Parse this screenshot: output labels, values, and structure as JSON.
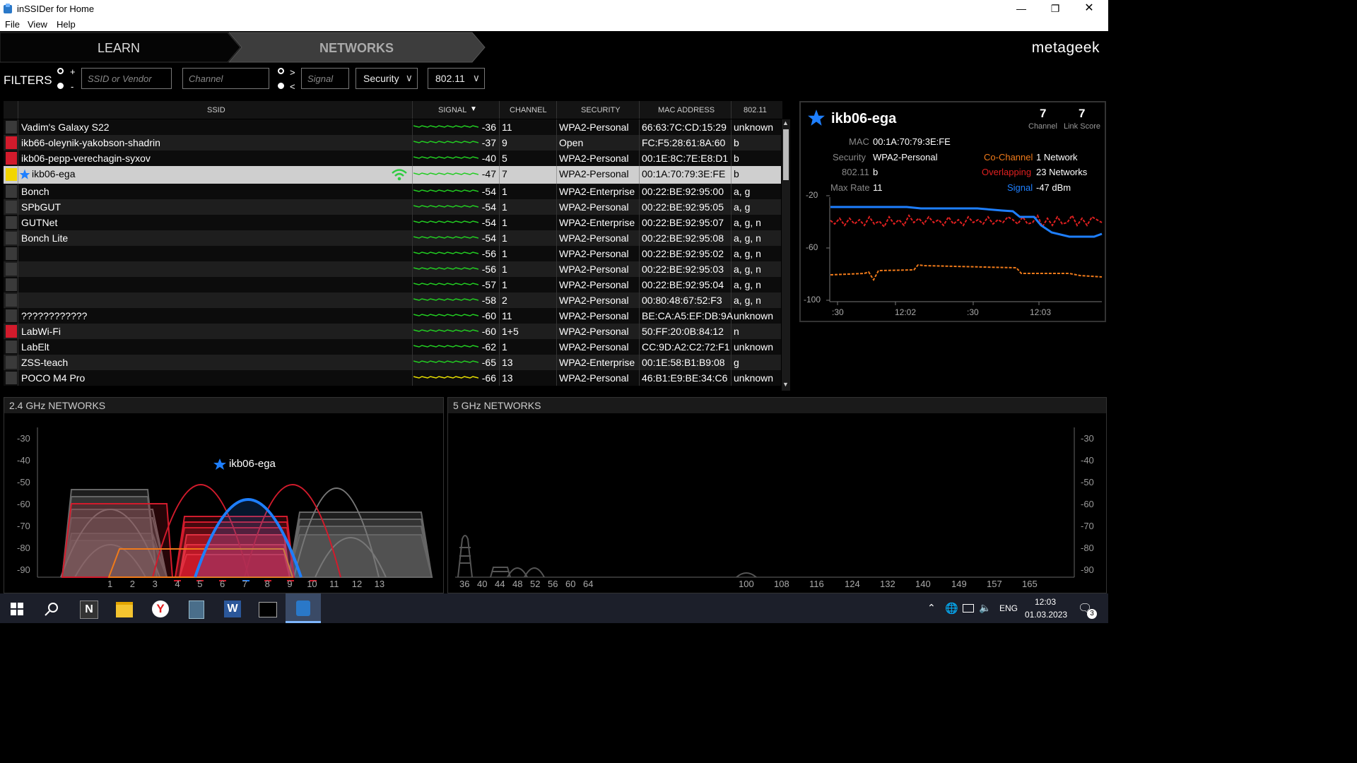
{
  "app": {
    "title": "inSSIDer for Home"
  },
  "menu": [
    "File",
    "View",
    "Help"
  ],
  "nav": {
    "learn": "LEARN",
    "networks": "NETWORKS",
    "brand": "metageek"
  },
  "filters": {
    "label": "FILTERS",
    "plus": "+",
    "minus": "-",
    "gt": ">",
    "lt": "<",
    "ssid_placeholder": "SSID or Vendor",
    "channel_placeholder": "Channel",
    "signal_placeholder": "Signal",
    "security": "Security",
    "dot11": "802.11"
  },
  "table": {
    "headers": {
      "ssid": "SSID",
      "signal": "SIGNAL",
      "channel": "CHANNEL",
      "security": "SECURITY",
      "mac": "MAC ADDRESS",
      "dot11": "802.11"
    },
    "rows": [
      {
        "color": "#3a3a3a",
        "ssid": "Vadim's Galaxy S22",
        "signal": "-36",
        "channel": "11",
        "security": "WPA2-Personal",
        "mac": "66:63:7C:CD:15:29",
        "dot11": "unknown",
        "spark": "#22cc22"
      },
      {
        "color": "#d21b2c",
        "ssid": "ikb66-oleynik-yakobson-shadrin",
        "signal": "-37",
        "channel": "9",
        "security": "Open",
        "mac": "FC:F5:28:61:8A:60",
        "dot11": "b",
        "spark": "#22cc22"
      },
      {
        "color": "#d21b2c",
        "ssid": "ikb06-pepp-verechagin-syxov",
        "signal": "-40",
        "channel": "5",
        "security": "WPA2-Personal",
        "mac": "00:1E:8C:7E:E8:D1",
        "dot11": "b",
        "spark": "#22cc22"
      },
      {
        "color": "#f2d600",
        "ssid": "ikb06-ega",
        "signal": "-47",
        "channel": "7",
        "security": "WPA2-Personal",
        "mac": "00:1A:70:79:3E:FE",
        "dot11": "b",
        "spark": "#22cc22",
        "selected": true
      },
      {
        "color": "#3a3a3a",
        "ssid": "Bonch",
        "signal": "-54",
        "channel": "1",
        "security": "WPA2-Enterprise",
        "mac": "00:22:BE:92:95:00",
        "dot11": "a, g",
        "spark": "#22cc22"
      },
      {
        "color": "#3a3a3a",
        "ssid": "SPbGUT",
        "signal": "-54",
        "channel": "1",
        "security": "WPA2-Personal",
        "mac": "00:22:BE:92:95:05",
        "dot11": "a, g",
        "spark": "#22cc22"
      },
      {
        "color": "#3a3a3a",
        "ssid": "GUTNet",
        "signal": "-54",
        "channel": "1",
        "security": "WPA2-Enterprise",
        "mac": "00:22:BE:92:95:07",
        "dot11": "a, g, n",
        "spark": "#22cc22"
      },
      {
        "color": "#3a3a3a",
        "ssid": "Bonch Lite",
        "signal": "-54",
        "channel": "1",
        "security": "WPA2-Personal",
        "mac": "00:22:BE:92:95:08",
        "dot11": "a, g, n",
        "spark": "#22cc22"
      },
      {
        "color": "#3a3a3a",
        "ssid": "",
        "signal": "-56",
        "channel": "1",
        "security": "WPA2-Personal",
        "mac": "00:22:BE:92:95:02",
        "dot11": "a, g, n",
        "spark": "#22cc22"
      },
      {
        "color": "#3a3a3a",
        "ssid": "",
        "signal": "-56",
        "channel": "1",
        "security": "WPA2-Personal",
        "mac": "00:22:BE:92:95:03",
        "dot11": "a, g, n",
        "spark": "#22cc22"
      },
      {
        "color": "#3a3a3a",
        "ssid": "",
        "signal": "-57",
        "channel": "1",
        "security": "WPA2-Personal",
        "mac": "00:22:BE:92:95:04",
        "dot11": "a, g, n",
        "spark": "#22cc22"
      },
      {
        "color": "#3a3a3a",
        "ssid": "",
        "signal": "-58",
        "channel": "2",
        "security": "WPA2-Personal",
        "mac": "00:80:48:67:52:F3",
        "dot11": "a, g, n",
        "spark": "#22cc22"
      },
      {
        "color": "#3a3a3a",
        "ssid": "????????????",
        "signal": "-60",
        "channel": "11",
        "security": "WPA2-Personal",
        "mac": "BE:CA:A5:EF:DB:9A",
        "dot11": "unknown",
        "spark": "#22cc22"
      },
      {
        "color": "#d21b2c",
        "ssid": "LabWi-Fi",
        "signal": "-60",
        "channel": "1+5",
        "security": "WPA2-Personal",
        "mac": "50:FF:20:0B:84:12",
        "dot11": "n",
        "spark": "#22cc22"
      },
      {
        "color": "#3a3a3a",
        "ssid": "LabElt",
        "signal": "-62",
        "channel": "1",
        "security": "WPA2-Personal",
        "mac": "CC:9D:A2:C2:72:F1",
        "dot11": "unknown",
        "spark": "#22cc22"
      },
      {
        "color": "#3a3a3a",
        "ssid": "ZSS-teach",
        "signal": "-65",
        "channel": "13",
        "security": "WPA2-Enterprise",
        "mac": "00:1E:58:B1:B9:08",
        "dot11": "g",
        "spark": "#22cc22"
      },
      {
        "color": "#3a3a3a",
        "ssid": "POCO M4 Pro",
        "signal": "-66",
        "channel": "13",
        "security": "WPA2-Personal",
        "mac": "46:B1:E9:BE:34:C6",
        "dot11": "unknown",
        "spark": "#e8e000"
      }
    ]
  },
  "detail": {
    "ssid": "ikb06-ega",
    "channel_value": "7",
    "channel_label": "Channel",
    "linkscore_value": "7",
    "linkscore_label": "Link Score",
    "mac_label": "MAC",
    "mac": "00:1A:70:79:3E:FE",
    "security_label": "Security",
    "security": "WPA2-Personal",
    "dot11_label": "802.11",
    "dot11": "b",
    "maxrate_label": "Max Rate",
    "maxrate": "11",
    "cochannel_label": "Co-Channel",
    "cochannel": "1 Network",
    "overlapping_label": "Overlapping",
    "overlapping": "23 Networks",
    "signal_label": "Signal",
    "signal": "-47 dBm",
    "y_ticks": [
      "-20",
      "-60",
      "-100"
    ],
    "x_ticks": [
      ":30",
      "12:02",
      ":30",
      "12:03"
    ],
    "colors": {
      "cochannel": "#f07a1a",
      "overlapping": "#e02020",
      "signal": "#1e7fff"
    }
  },
  "band24": {
    "title": "2.4 GHz NETWORKS",
    "y_ticks": [
      "-30",
      "-40",
      "-50",
      "-60",
      "-70",
      "-80",
      "-90"
    ],
    "x_ticks": [
      "1",
      "2",
      "3",
      "4",
      "5",
      "6",
      "7",
      "8",
      "9",
      "10",
      "11",
      "12",
      "13"
    ],
    "selected_label": "ikb06-ega"
  },
  "band5": {
    "title": "5 GHz NETWORKS",
    "y_ticks": [
      "-30",
      "-40",
      "-50",
      "-60",
      "-70",
      "-80",
      "-90"
    ],
    "x_ticks": [
      "36",
      "40",
      "44",
      "48",
      "52",
      "56",
      "60",
      "64",
      "100",
      "108",
      "116",
      "124",
      "132",
      "140",
      "149",
      "157",
      "165"
    ]
  },
  "taskbar": {
    "lang": "ENG",
    "time": "12:03",
    "date": "01.03.2023",
    "notif_count": "3",
    "apps": [
      "start-icon",
      "search-icon",
      "notion-icon",
      "file-explorer-icon",
      "yandex-browser-icon",
      "calculator-icon",
      "word-icon",
      "terminal-icon",
      "inssider-icon"
    ]
  }
}
